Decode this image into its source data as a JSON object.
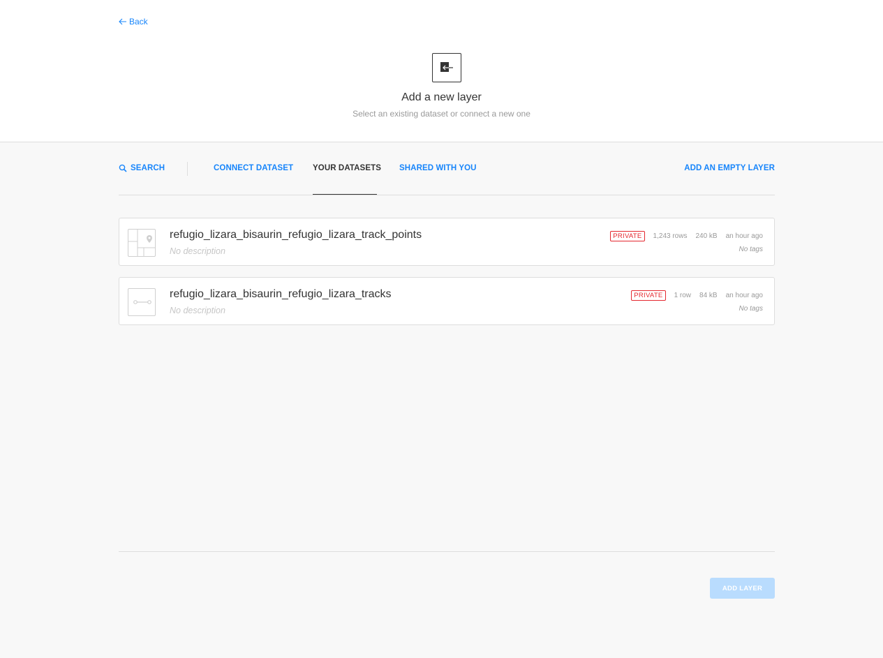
{
  "nav": {
    "back_label": "Back"
  },
  "header": {
    "title": "Add a new layer",
    "subtitle": "Select an existing dataset or connect a new one"
  },
  "tabs": {
    "search": "SEARCH",
    "connect": "CONNECT DATASET",
    "yours": "YOUR DATASETS",
    "shared": "SHARED WITH YOU",
    "empty_layer": "ADD AN EMPTY LAYER",
    "active": "YOUR DATASETS"
  },
  "datasets": [
    {
      "name": "refugio_lizara_bisaurin_refugio_lizara_track_points",
      "description": "No description",
      "privacy": "PRIVATE",
      "rows": "1,243 rows",
      "size": "240 kB",
      "updated": "an hour ago",
      "tags": "No tags",
      "geometry_icon": "point-map-icon"
    },
    {
      "name": "refugio_lizara_bisaurin_refugio_lizara_tracks",
      "description": "No description",
      "privacy": "PRIVATE",
      "rows": "1 row",
      "size": "84 kB",
      "updated": "an hour ago",
      "tags": "No tags",
      "geometry_icon": "line-geometry-icon"
    }
  ],
  "footer": {
    "add_layer_label": "ADD LAYER",
    "add_layer_enabled": false
  },
  "colors": {
    "accent": "#1785fb",
    "private_badge": "#e4272e",
    "disabled_button": "#b9dcfe"
  }
}
